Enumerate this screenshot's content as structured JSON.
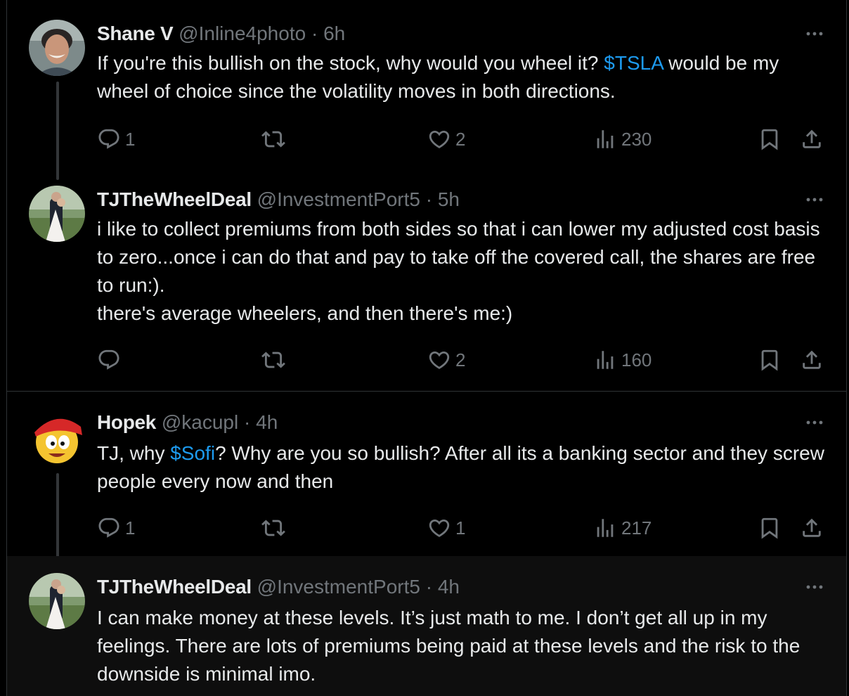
{
  "tweets": [
    {
      "name": "Shane V",
      "handle": "@Inline4photo",
      "dot": "·",
      "time": "6h",
      "text_before": "If you're this bullish on the stock, why would you wheel it? ",
      "cashtag": "$TSLA",
      "text_after": " would be my wheel of choice since the volatility moves in both directions.",
      "replies": "1",
      "retweets": "",
      "likes": "2",
      "views": "230"
    },
    {
      "name": "TJTheWheelDeal",
      "handle": "@InvestmentPort5",
      "dot": "·",
      "time": "5h",
      "lines": [
        "i like to collect premiums from both sides so that i can lower my adjusted cost basis to zero...once i can do that and pay to take off the covered call, the shares are free to run:).",
        "there's average wheelers, and then there's me:)"
      ],
      "replies": "",
      "retweets": "",
      "likes": "2",
      "views": "160"
    },
    {
      "name": "Hopek",
      "handle": "@kacupl",
      "dot": "·",
      "time": "4h",
      "text_before": "TJ, why ",
      "cashtag": "$Sofi",
      "text_after": "? Why are you so bullish? After all its a banking sector and they screw people every now and then",
      "replies": "1",
      "retweets": "",
      "likes": "1",
      "views": "217"
    },
    {
      "name": "TJTheWheelDeal",
      "handle": "@InvestmentPort5",
      "dot": "·",
      "time": "4h",
      "text": "I can make money at these levels. It’s just math to me. I don’t get all up in my feelings. There are lots of premiums being paid at these levels and the risk to the downside is minimal imo."
    }
  ],
  "icons": {
    "reply": "reply-icon",
    "retweet": "retweet-icon",
    "like": "heart-icon",
    "views": "views-icon",
    "bookmark": "bookmark-icon",
    "share": "share-icon",
    "more": "more-icon"
  },
  "colors": {
    "background": "#000000",
    "text": "#e7e9ea",
    "muted": "#71767b",
    "link": "#1d9bf0",
    "border": "#2f3336",
    "highlight": "#0e0e0e"
  }
}
